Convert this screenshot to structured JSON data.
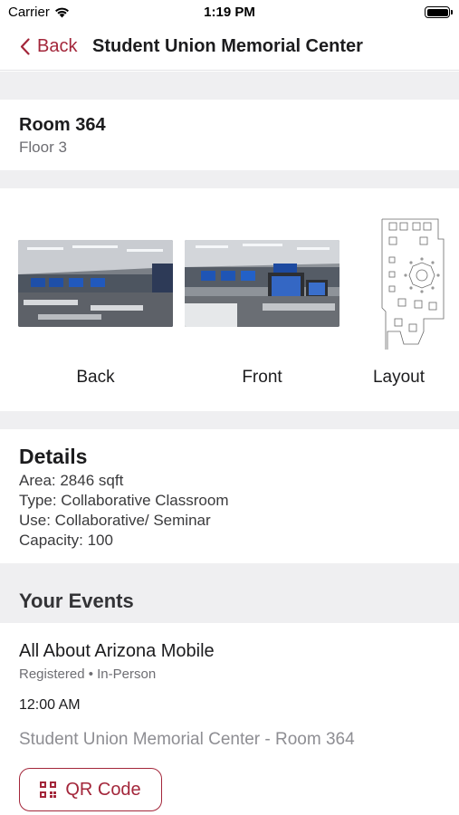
{
  "status_bar": {
    "carrier": "Carrier",
    "time": "1:19 PM"
  },
  "nav": {
    "back_label": "Back",
    "title": "Student Union Memorial Center"
  },
  "room": {
    "name": "Room 364",
    "floor": "Floor 3"
  },
  "photos": [
    {
      "label": "Back"
    },
    {
      "label": "Front"
    },
    {
      "label": "Layout"
    }
  ],
  "details": {
    "title": "Details",
    "lines": [
      "Area: 2846 sqft",
      "Type: Collaborative Classroom",
      "Use: Collaborative/ Seminar",
      "Capacity: 100"
    ]
  },
  "events": {
    "title": "Your Events",
    "items": [
      {
        "title": "All About Arizona Mobile",
        "meta": "Registered • In-Person",
        "time": "12:00 AM",
        "location": "Student Union Memorial Center - Room 364",
        "qr_label": "QR Code"
      }
    ]
  },
  "colors": {
    "accent": "#a3263a",
    "separator": "#efeff1"
  }
}
